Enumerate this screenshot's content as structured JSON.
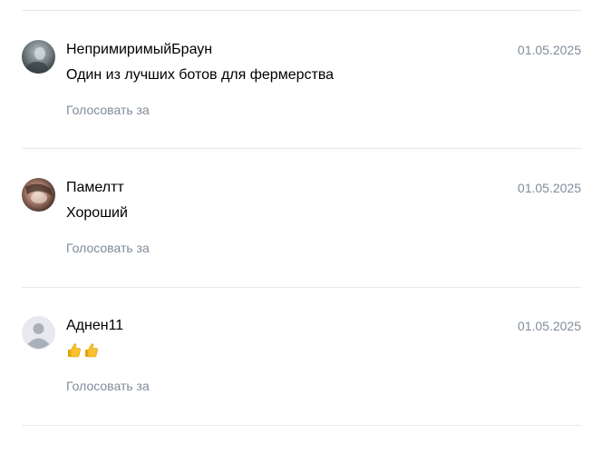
{
  "reviews": [
    {
      "author": "НепримиримыйБраун",
      "date": "01.05.2025",
      "text": "Один из лучших ботов для фермерства",
      "vote_label": "Голосовать за",
      "avatar_icon": "user-photo-icon"
    },
    {
      "author": "Памелтт",
      "date": "01.05.2025",
      "text": "Хороший",
      "vote_label": "Голосовать за",
      "avatar_icon": "user-photo-icon"
    },
    {
      "author": "Аднен11",
      "date": "01.05.2025",
      "text": "",
      "emoji": [
        "thumbs-up",
        "thumbs-up"
      ],
      "vote_label": "Голосовать за",
      "avatar_icon": "default-user-icon"
    }
  ],
  "colors": {
    "divider": "#e7e8ec",
    "secondary_text": "#818c99",
    "primary_text": "#000000",
    "default_avatar_bg": "#e7e9ee",
    "default_avatar_fg": "#aab0b9"
  }
}
